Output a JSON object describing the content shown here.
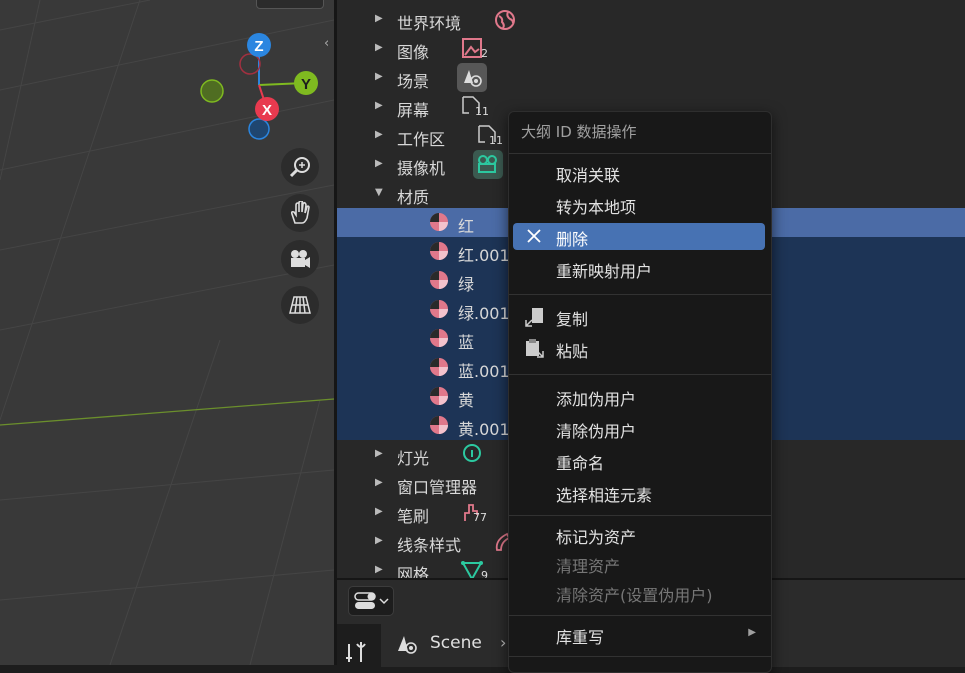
{
  "viewport": {
    "axes": {
      "x": "X",
      "y": "Y",
      "z": "Z"
    }
  },
  "outliner": {
    "rows": [
      {
        "label": "世界环境",
        "expanded": false,
        "icon": "world-icon"
      },
      {
        "label": "图像",
        "expanded": false,
        "icon": "image-icon",
        "count": "2"
      },
      {
        "label": "场景",
        "expanded": false,
        "icon": "scene-icon"
      },
      {
        "label": "屏幕",
        "expanded": false,
        "icon": "screen-icon",
        "count": "11"
      },
      {
        "label": "工作区",
        "expanded": false,
        "icon": "workspace-icon",
        "count": "11"
      },
      {
        "label": "摄像机",
        "expanded": false,
        "icon": "camera-data-icon"
      },
      {
        "label": "材质",
        "expanded": true
      },
      {
        "label": "灯光",
        "expanded": false,
        "icon": "light-icon"
      },
      {
        "label": "窗口管理器",
        "expanded": false
      },
      {
        "label": "笔刷",
        "expanded": false,
        "icon": "brush-icon",
        "count": "77"
      },
      {
        "label": "线条样式",
        "expanded": false,
        "icon": "linestyle-icon"
      },
      {
        "label": "网格",
        "expanded": false,
        "icon": "mesh-icon",
        "count": "9"
      }
    ],
    "materials": [
      "红",
      "红.001",
      "绿",
      "绿.001",
      "蓝",
      "蓝.001",
      "黄",
      "黄.001"
    ],
    "active_material": "红"
  },
  "context_menu": {
    "title": "大纲 ID 数据操作",
    "groups": [
      [
        {
          "label": "取消关联"
        },
        {
          "label": "转为本地项"
        },
        {
          "label": "删除",
          "highlighted": true,
          "icon": "close-icon"
        },
        {
          "label": "重新映射用户"
        }
      ],
      [
        {
          "label": "复制",
          "icon": "copy-icon"
        },
        {
          "label": "粘贴",
          "icon": "paste-icon"
        }
      ],
      [
        {
          "label": "添加伪用户"
        },
        {
          "label": "清除伪用户"
        },
        {
          "label": "重命名"
        },
        {
          "label": "选择相连元素"
        }
      ],
      [
        {
          "label": "标记为资产"
        },
        {
          "label": "清理资产",
          "disabled": true
        },
        {
          "label": "清除资产(设置伪用户)",
          "disabled": true
        }
      ],
      [
        {
          "label": "库重写",
          "submenu": true
        }
      ]
    ]
  },
  "properties": {
    "scene_label": "Scene"
  },
  "colors": {
    "accent": "#4772b3",
    "selection": "#1d3456",
    "active_row": "#4b6ba6",
    "x_axis": "#e83a4f",
    "y_axis": "#7fba20",
    "z_axis": "#2b86e0",
    "material_icon": "#e0788b"
  }
}
